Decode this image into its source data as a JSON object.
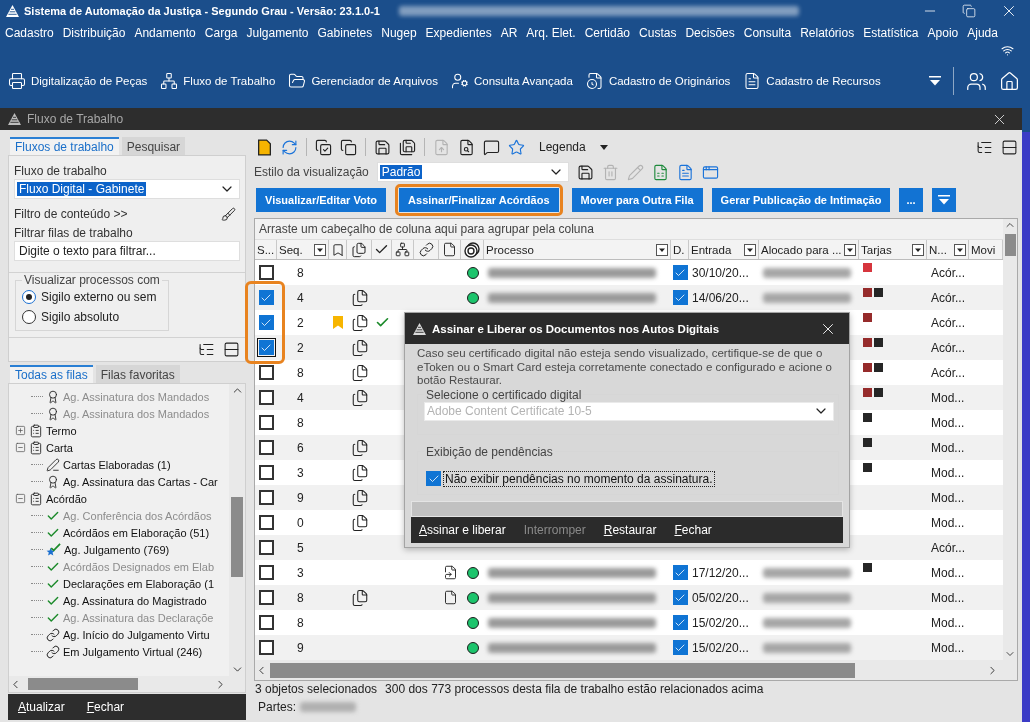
{
  "window": {
    "title": "Sistema de Automação da Justiça - Segundo Grau - Versão: 23.1.0-1"
  },
  "menu": [
    "Cadastro",
    "Distribuição",
    "Andamento",
    "Carga",
    "Julgamento",
    "Gabinetes",
    "Nugep",
    "Expedientes",
    "AR",
    "Arq. Elet.",
    "Certidão",
    "Custas",
    "Decisões",
    "Consulta",
    "Relatórios",
    "Estatística",
    "Apoio",
    "Ajuda"
  ],
  "toolbar": [
    {
      "label": "Digitalização de Peças",
      "kind": "scanner"
    },
    {
      "label": "Fluxo de Trabalho",
      "kind": "workflow"
    },
    {
      "label": "Gerenciador de Arquivos",
      "kind": "files"
    },
    {
      "label": "Consulta Avançada",
      "kind": "search"
    },
    {
      "label": "Cadastro de Originários",
      "kind": "originals"
    },
    {
      "label": "Cadastro de Recursos",
      "kind": "appeals"
    }
  ],
  "workspace": {
    "title": "Fluxo de Trabalho"
  },
  "left_panel": {
    "tabs": [
      {
        "label": "Fluxos de trabalho",
        "selected": true
      },
      {
        "label": "Pesquisar",
        "selected": false
      }
    ],
    "workflow_label": "Fluxo de trabalho",
    "workflow_value": "Fluxo Digital - Gabinete",
    "content_filter": "Filtro de conteúdo >>",
    "queue_filter_label": "Filtrar filas de trabalho",
    "queue_filter": {
      "placeholder": "Digite o texto para filtrar..."
    },
    "visibility": {
      "legend": "Visualizar processos com",
      "options": [
        {
          "label": "Sigilo externo ou sem",
          "selected": true
        },
        {
          "label": "Sigilo absoluto",
          "selected": false
        }
      ]
    },
    "queue_tabs": [
      {
        "label": "Todas as filas",
        "selected": true
      },
      {
        "label": "Filas favoritas",
        "selected": false
      }
    ],
    "tree": [
      {
        "children": [
          {
            "label": "Ag. Assinatura dos Mandados",
            "kind": "seal",
            "disabled": true
          },
          {
            "label": "Ag. Assinatura dos Mandados",
            "kind": "seal",
            "disabled": true
          }
        ]
      },
      {
        "label": "Termo",
        "kind": "folder",
        "expanded": false,
        "disabled": false
      },
      {
        "label": "Carta",
        "kind": "folder",
        "expanded": true,
        "disabled": false,
        "children": [
          {
            "label": "Cartas Elaboradas (1)",
            "kind": "pen",
            "disabled": false
          },
          {
            "label": "Ag. Assinatura das Cartas - Car",
            "kind": "seal",
            "disabled": false
          }
        ]
      },
      {
        "label": "Acórdão",
        "kind": "folder",
        "expanded": true,
        "disabled": false,
        "children": [
          {
            "label": "Ag. Conferência dos Acórdãos",
            "kind": "check",
            "disabled": true
          },
          {
            "label": "Acórdãos em Elaboração (51)",
            "kind": "check",
            "disabled": false
          },
          {
            "label": "Ag. Julgamento (769)",
            "kind": "star",
            "disabled": false
          },
          {
            "label": "Acórdãos Designados em Elab",
            "kind": "check",
            "disabled": true
          },
          {
            "label": "Declarações em Elaboração (1",
            "kind": "check",
            "disabled": false
          },
          {
            "label": "Ag. Assinatura do Magistrado",
            "kind": "check",
            "disabled": false
          },
          {
            "label": "Ag. Assinatura das Declaraçõe",
            "kind": "check",
            "disabled": true
          },
          {
            "label": "Ag. Início do Julgamento Virtu",
            "kind": "link",
            "disabled": false
          },
          {
            "label": "Em Julgamento Virtual (246)",
            "kind": "link",
            "disabled": false
          }
        ]
      }
    ],
    "footer": [
      {
        "label": "Atualizar"
      },
      {
        "label": "Fechar"
      }
    ]
  },
  "grid_toolbar": {
    "tools": [
      {
        "kind": "note",
        "disabled": false
      },
      {
        "kind": "refresh",
        "disabled": false
      },
      {
        "kind": "separator"
      },
      {
        "kind": "checkcopy",
        "disabled": false
      },
      {
        "kind": "copy",
        "disabled": false
      },
      {
        "kind": "separator"
      },
      {
        "kind": "savedoc",
        "disabled": false
      },
      {
        "kind": "savedocs",
        "disabled": false
      },
      {
        "kind": "separator"
      },
      {
        "kind": "export",
        "disabled": true
      },
      {
        "kind": "inspect",
        "disabled": false
      },
      {
        "kind": "comment",
        "disabled": false
      },
      {
        "kind": "favorite",
        "disabled": false
      }
    ],
    "legend": "Legenda"
  },
  "view_style": {
    "label": "Estilo da visualização",
    "value": "Padrão",
    "tools": [
      {
        "kind": "save",
        "disabled": false
      },
      {
        "kind": "delete",
        "disabled": true
      },
      {
        "kind": "edit",
        "disabled": true
      },
      {
        "kind": "excel",
        "disabled": false
      },
      {
        "kind": "document",
        "disabled": false
      },
      {
        "kind": "window",
        "disabled": false
      }
    ]
  },
  "actions": [
    {
      "label": "Visualizar/Editar Voto",
      "highlighted": false
    },
    {
      "label": "Assinar/Finalizar Acórdãos",
      "highlighted": true
    },
    {
      "label": "Mover para Outra Fila",
      "highlighted": false
    },
    {
      "label": "Gerar Publicação de Intimação",
      "highlighted": false
    },
    {
      "label": "...",
      "highlighted": false
    }
  ],
  "grid": {
    "group_hint": "Arraste um cabeçalho de coluna aqui para agrupar pela coluna",
    "highlight_selection": true,
    "columns": [
      {
        "label": "S...",
        "filter": false
      },
      {
        "label": "Seq.",
        "filter": true
      },
      {
        "label": "Processo",
        "filter": true
      },
      {
        "label": "D.",
        "filter": false
      },
      {
        "label": "Entrada",
        "filter": true
      },
      {
        "label": "Alocado para ...",
        "filter": true
      },
      {
        "label": "Tarjas",
        "filter": true
      },
      {
        "label": "N...",
        "filter": true
      },
      {
        "label": "Movi",
        "filter": false
      }
    ],
    "rows": [
      {
        "checked": false,
        "focused": false,
        "seq": "8",
        "bookmark": false,
        "documents": false,
        "done": false,
        "status_dot": true,
        "redacted": true,
        "d_checked": true,
        "entrada": "30/10/20...",
        "tarjas": [
          {
            "color": "#d6353d"
          }
        ],
        "n": "Acór..."
      },
      {
        "checked": true,
        "focused": false,
        "seq": "4",
        "bookmark": false,
        "documents": true,
        "done": false,
        "status_dot": true,
        "redacted": true,
        "d_checked": true,
        "entrada": "14/06/20...",
        "tarjas": [
          {
            "color": "#962b2b"
          },
          {
            "color": "#262626"
          }
        ],
        "n": "Acór..."
      },
      {
        "checked": true,
        "focused": false,
        "seq": "2",
        "bookmark": true,
        "documents": true,
        "done": true,
        "tarjas": [
          {
            "color": "#962b2b"
          }
        ],
        "n": "Acór..."
      },
      {
        "checked": true,
        "focused": true,
        "seq": "2",
        "bookmark": false,
        "documents": true,
        "done": false,
        "tarjas": [
          {
            "color": "#962b2b"
          },
          {
            "color": "#262626"
          }
        ],
        "n": "Acór..."
      },
      {
        "checked": false,
        "focused": false,
        "seq": "8",
        "bookmark": false,
        "documents": true,
        "done": false,
        "tarjas": [
          {
            "color": "#962b2b"
          },
          {
            "color": "#262626"
          }
        ],
        "n": "Acór..."
      },
      {
        "checked": false,
        "focused": false,
        "seq": "4",
        "bookmark": false,
        "documents": true,
        "done": false,
        "tarjas": [
          {
            "color": "#962b2b"
          },
          {
            "color": "#262626"
          }
        ],
        "n": "Mod..."
      },
      {
        "checked": false,
        "focused": false,
        "seq": "8",
        "bookmark": false,
        "documents": false,
        "done": false,
        "tarjas": [
          {
            "color": "#262626"
          }
        ],
        "n": "Mod..."
      },
      {
        "checked": false,
        "focused": false,
        "seq": "6",
        "bookmark": false,
        "documents": true,
        "done": false,
        "tarjas": [
          {
            "color": "#262626"
          }
        ],
        "n": "Mod..."
      },
      {
        "checked": false,
        "focused": false,
        "seq": "3",
        "bookmark": false,
        "documents": true,
        "done": false,
        "tarjas": [
          {
            "color": "#262626"
          }
        ],
        "n": "Mod..."
      },
      {
        "checked": false,
        "focused": false,
        "seq": "9",
        "bookmark": false,
        "documents": true,
        "done": false,
        "n": "Mod..."
      },
      {
        "checked": false,
        "focused": false,
        "seq": "0",
        "bookmark": false,
        "documents": true,
        "done": false,
        "n": "Mod..."
      },
      {
        "checked": false,
        "focused": false,
        "seq": "5",
        "bookmark": false,
        "documents": false,
        "done": false,
        "n": "Acór..."
      },
      {
        "checked": false,
        "focused": false,
        "seq": "3",
        "bookmark": false,
        "documents": false,
        "done": false,
        "attachment": {
          "kind": "linked"
        },
        "status_dot": true,
        "redacted": true,
        "d_checked": true,
        "entrada": "17/12/20...",
        "tarjas": [
          {
            "color": "#262626"
          }
        ],
        "n": "Mod..."
      },
      {
        "checked": false,
        "focused": false,
        "seq": "8",
        "bookmark": false,
        "documents": true,
        "done": false,
        "attachment": {
          "kind": "plain"
        },
        "status_dot": true,
        "redacted": true,
        "d_checked": true,
        "entrada": "05/02/20...",
        "n": "Mod..."
      },
      {
        "checked": false,
        "focused": false,
        "seq": "8",
        "bookmark": false,
        "documents": false,
        "done": false,
        "status_dot": true,
        "redacted": true,
        "d_checked": true,
        "entrada": "15/02/20...",
        "n": "Mod..."
      },
      {
        "checked": false,
        "focused": false,
        "seq": "9",
        "bookmark": false,
        "documents": false,
        "done": false,
        "status_dot": true,
        "redacted": true,
        "d_checked": true,
        "entrada": "15/02/20...",
        "n": "Mod..."
      }
    ]
  },
  "status_bar": {
    "selection": "3 objetos selecionados",
    "summary": "300 dos 773 processos desta fila de trabalho estão relacionados acima"
  },
  "details": {
    "label": "Partes:"
  },
  "dialog": {
    "title": "Assinar e Liberar os Documentos nos Autos Digitais",
    "message": "Caso seu certificado digital não esteja sendo visualizado, certifique-se de que o eToken ou o Smart Card esteja corretamente conectado e configurado e acione o botão Restaurar.",
    "certificate": {
      "legend": "Selecione o certificado digital",
      "value": "Adobe Content Certificate 10-5",
      "disabled": true
    },
    "pending": {
      "legend": "Exibição de pendências",
      "label": "Não exibir pendências no momento da assinatura.",
      "checked": true
    },
    "buttons": [
      {
        "label": "Assinar e liberar",
        "disabled": false
      },
      {
        "label": "Interromper",
        "disabled": true
      },
      {
        "label": "Restaurar",
        "disabled": false
      },
      {
        "label": "Fechar",
        "disabled": false
      }
    ]
  }
}
